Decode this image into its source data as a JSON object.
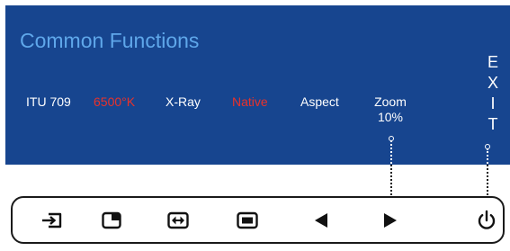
{
  "osd": {
    "title": "Common Functions",
    "functions": [
      {
        "label": "ITU 709",
        "active": false
      },
      {
        "label": "6500°K",
        "active": true
      },
      {
        "label": "X-Ray",
        "active": false
      },
      {
        "label": "Native",
        "active": true
      },
      {
        "label": "Aspect",
        "active": false
      }
    ],
    "zoom": {
      "label": "Zoom",
      "value": "10%"
    },
    "exit_letters": [
      "E",
      "X",
      "I",
      "T"
    ]
  },
  "colors": {
    "panel": "#17458f",
    "title": "#5fa7ea",
    "active": "#e8322b",
    "text": "#ffffff"
  },
  "bezel_buttons": [
    {
      "icon": "input-icon"
    },
    {
      "icon": "window-corner-icon"
    },
    {
      "icon": "fit-width-icon"
    },
    {
      "icon": "frame-icon"
    },
    {
      "icon": "left-arrow-icon"
    },
    {
      "icon": "right-arrow-icon"
    },
    {
      "icon": "power-icon"
    }
  ]
}
